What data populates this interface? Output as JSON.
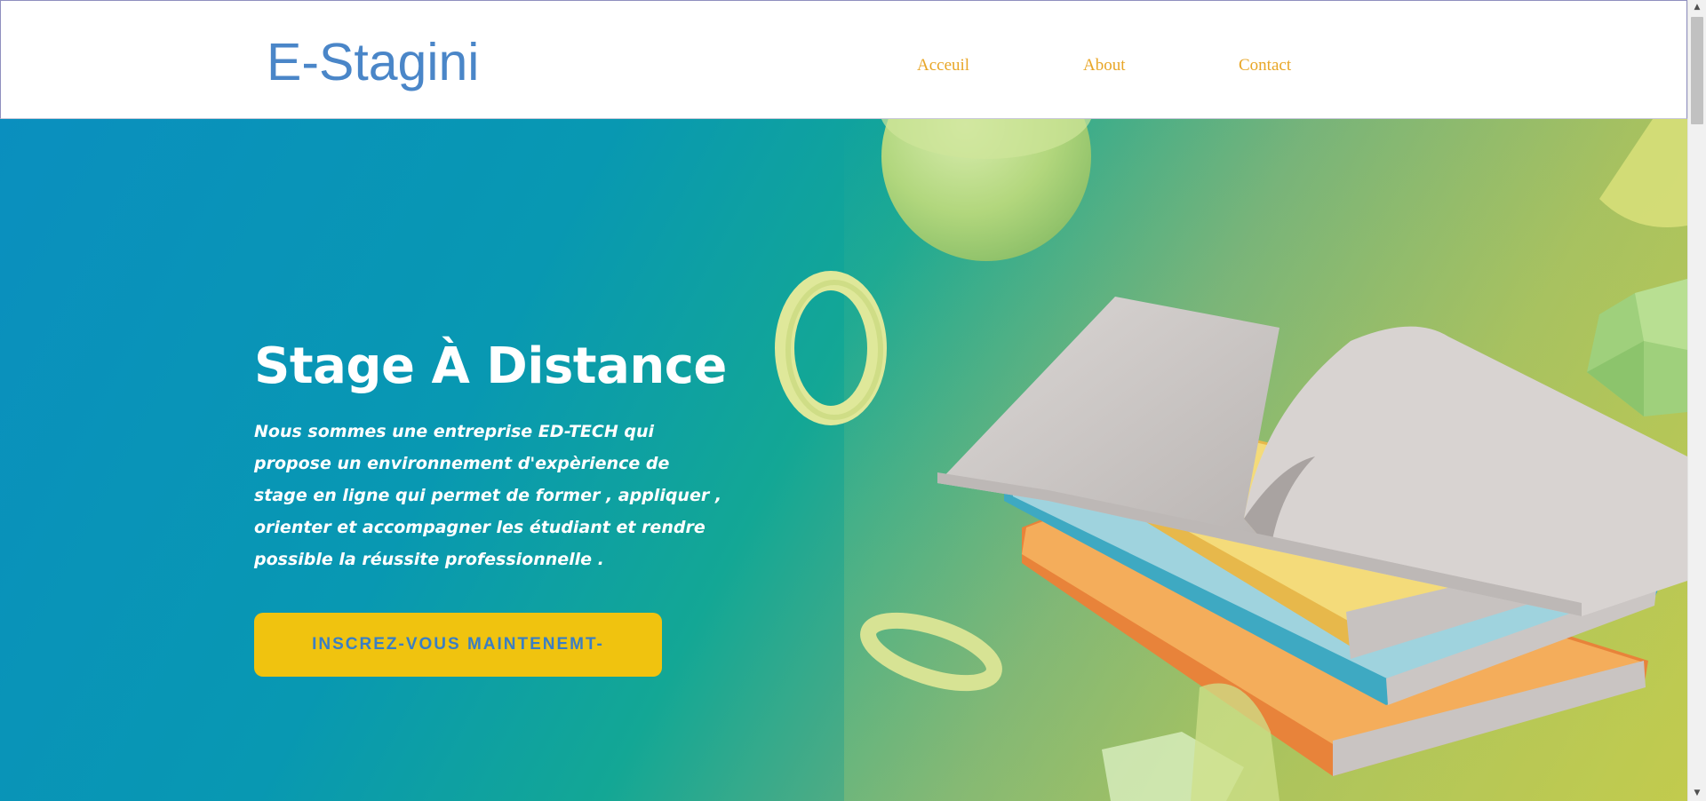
{
  "header": {
    "logo": "E-Stagini",
    "nav": [
      {
        "label": "Acceuil"
      },
      {
        "label": "About"
      },
      {
        "label": "Contact"
      }
    ]
  },
  "hero": {
    "title": "Stage À Distance",
    "description": "Nous sommes une entreprise ED-TECH qui propose un environnement d'expèrience de stage en ligne qui permet de former , appliquer , orienter et accompagner les étudiant et rendre possible la réussite professionnelle  .",
    "cta_label": "INSCREZ-VOUS MAINTENEMT-",
    "illustration": "stack-of-books-with-floating-shapes"
  },
  "scrollbar": {
    "up_icon": "triangle-up-icon",
    "down_icon": "triangle-down-icon"
  },
  "colors": {
    "logo": "#4a86c8",
    "nav_link": "#e8a627",
    "cta_background": "#f0c30f",
    "cta_text": "#3a7ec4",
    "hero_gradient_start": "#0a8fbf",
    "hero_gradient_end": "#b9c44d"
  }
}
